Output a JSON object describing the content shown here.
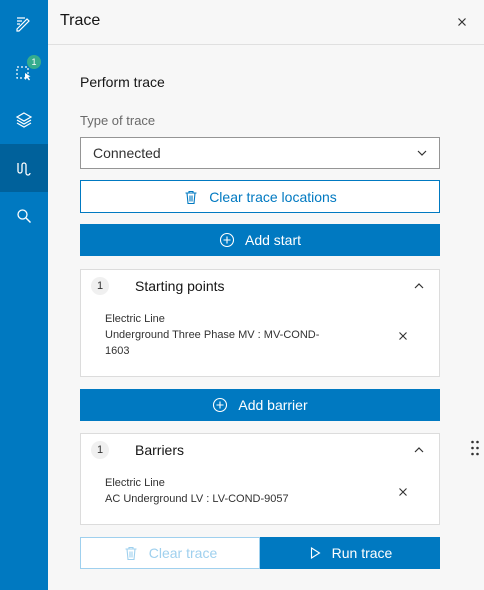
{
  "rail": {
    "badge_count": "1",
    "items": [
      {
        "name": "edit-icon"
      },
      {
        "name": "select-icon"
      },
      {
        "name": "layers-icon"
      },
      {
        "name": "trace-icon"
      },
      {
        "name": "search-icon"
      }
    ]
  },
  "header": {
    "title": "Trace"
  },
  "main": {
    "section_title": "Perform trace",
    "type_label": "Type of trace",
    "type_value": "Connected",
    "clear_locations_label": "Clear trace locations",
    "add_start_label": "Add start",
    "starting_points": {
      "count": "1",
      "title": "Starting points",
      "item_line1": "Electric Line",
      "item_line2": "Underground Three Phase MV : MV-COND-",
      "item_line3": "1603"
    },
    "add_barrier_label": "Add barrier",
    "barriers": {
      "count": "1",
      "title": "Barriers",
      "item_line1": "Electric Line",
      "item_line2": "AC Underground LV : LV-COND-9057"
    },
    "clear_trace_label": "Clear trace",
    "run_trace_label": "Run trace"
  },
  "colors": {
    "brand": "#0079c1",
    "rail_active": "#00619b",
    "badge": "#35ac8e",
    "disabled": "#9fd0ee"
  }
}
